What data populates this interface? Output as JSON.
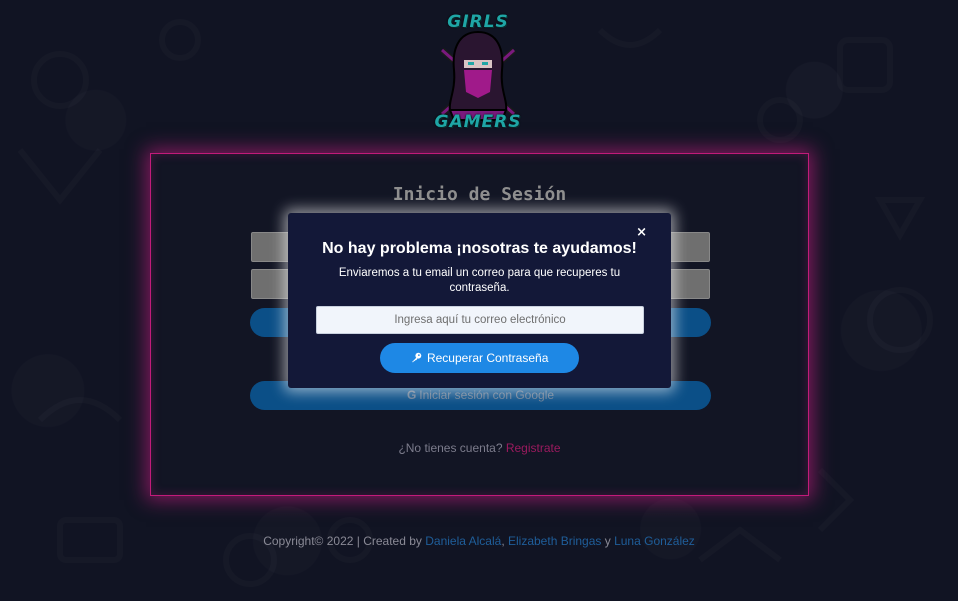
{
  "logo": {
    "line1": "GIRLS",
    "line2": "GAMERS"
  },
  "login": {
    "title": "Inicio de Sesión",
    "google_button": "Iniciar sesión con Google",
    "google_glyph": "G",
    "signup_prompt": "¿No tienes cuenta?",
    "signup_link": "Registrate"
  },
  "modal": {
    "close": "×",
    "title": "No hay problema ¡nosotras te ayudamos!",
    "text": "Enviaremos a tu email un correo para que recuperes tu contraseña.",
    "email_placeholder": "Ingresa aquí tu correo electrónico",
    "button_label": "Recuperar Contraseña",
    "button_icon": "key-icon"
  },
  "footer": {
    "prefix": "Copyright© 2022 | Created by",
    "author1": "Daniela Alcalá",
    "sep": ",",
    "author2": "Elizabeth Bringas",
    "and": "y",
    "author3": "Luna González"
  },
  "colors": {
    "accent_pink": "#c21b7a",
    "button_blue": "#1e88e5",
    "modal_bg": "#131838",
    "teal": "#1fa6a6"
  }
}
